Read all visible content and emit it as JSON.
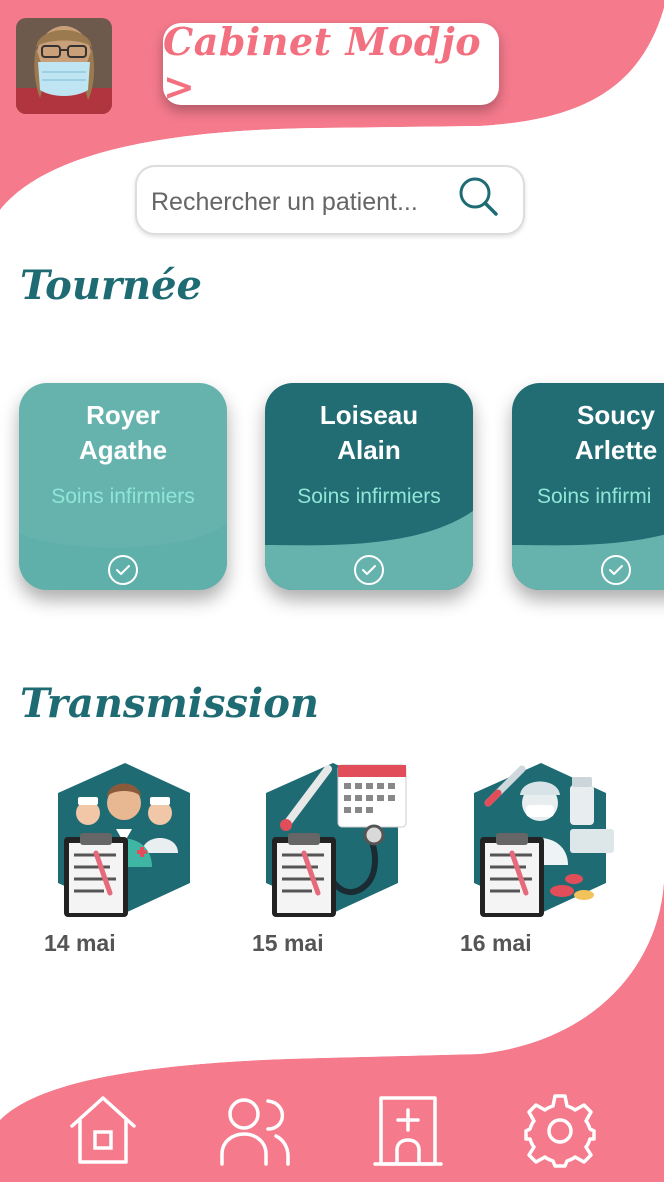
{
  "header": {
    "cabinet_label": "Cabinet Modjo >"
  },
  "search": {
    "placeholder": "Rechercher un patient..."
  },
  "tournee": {
    "title": "Tournée",
    "patients": [
      {
        "last_name": "Royer",
        "first_name": "Agathe",
        "care_type": "Soins infirmiers",
        "status": "done"
      },
      {
        "last_name": "Loiseau",
        "first_name": "Alain",
        "care_type": "Soins infirmiers",
        "status": "done"
      },
      {
        "last_name": "Soucy",
        "first_name": "Arlette",
        "care_type": "Soins infirmi",
        "status": "done"
      }
    ]
  },
  "transmission": {
    "title": "Transmission",
    "items": [
      {
        "date": "14 mai",
        "icon": "care-team-icon"
      },
      {
        "date": "15 mai",
        "icon": "vitals-icon"
      },
      {
        "date": "16 mai",
        "icon": "medication-icon"
      }
    ]
  },
  "nav": {
    "items": [
      "home-icon",
      "patients-icon",
      "clinic-icon",
      "settings-icon"
    ]
  },
  "colors": {
    "brand_pink": "#F47A8C",
    "teal_dark": "#1F6B73",
    "teal_light": "#66B3AE",
    "accent_text": "#8FE6D6"
  }
}
